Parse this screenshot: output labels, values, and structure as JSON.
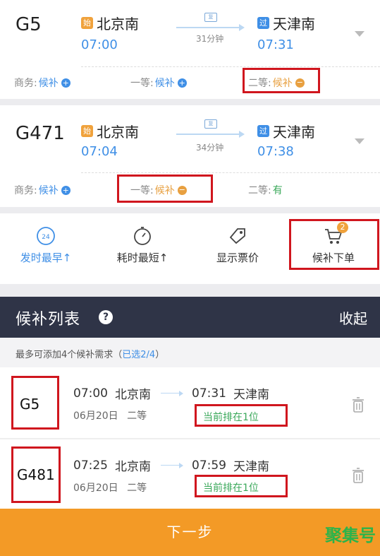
{
  "trains": [
    {
      "number": "G5",
      "from": {
        "badge": "始",
        "name": "北京南",
        "time": "07:00"
      },
      "to": {
        "badge": "过",
        "name": "天津南",
        "time": "07:31"
      },
      "type_badge": "复",
      "duration": "31分钟",
      "seats": [
        {
          "label": "商务:",
          "status": "候补"
        },
        {
          "label": "一等:",
          "status": "候补"
        },
        {
          "label": "二等:",
          "status": "候补"
        }
      ]
    },
    {
      "number": "G471",
      "from": {
        "badge": "始",
        "name": "北京南",
        "time": "07:04"
      },
      "to": {
        "badge": "过",
        "name": "天津南",
        "time": "07:38"
      },
      "type_badge": "复",
      "duration": "34分钟",
      "seats": [
        {
          "label": "商务:",
          "status": "候补"
        },
        {
          "label": "一等:",
          "status": "候补"
        },
        {
          "label": "二等:",
          "status": "有"
        }
      ]
    }
  ],
  "toolbar": {
    "clock_number": "24",
    "depart_sort": "发时最早↑",
    "duration_sort": "耗时最短↑",
    "show_price": "显示票价",
    "waitlist_order": "候补下单",
    "cart_count": "2"
  },
  "waitlist": {
    "title": "候补列表",
    "help": "?",
    "collapse": "收起",
    "hint_prefix": "最多可添加4个候补需求（",
    "hint_count": "已选2/4",
    "hint_suffix": "）",
    "items": [
      {
        "train": "G5",
        "depart_time": "07:00",
        "from": "北京南",
        "arrive_time": "07:31",
        "to": "天津南",
        "date": "06月20日",
        "seat": "二等",
        "rank": "当前排在1位"
      },
      {
        "train": "G481",
        "depart_time": "07:25",
        "from": "北京南",
        "arrive_time": "07:59",
        "to": "天津南",
        "date": "06月20日",
        "seat": "二等",
        "rank": "当前排在1位"
      }
    ]
  },
  "next_button": "下一步",
  "watermark": "聚集号",
  "colors": {
    "blue": "#3f8fe6",
    "orange": "#f39a26",
    "green": "#3aa85a",
    "highlight_red": "#d0161e",
    "panel_dark": "#2f3447"
  }
}
